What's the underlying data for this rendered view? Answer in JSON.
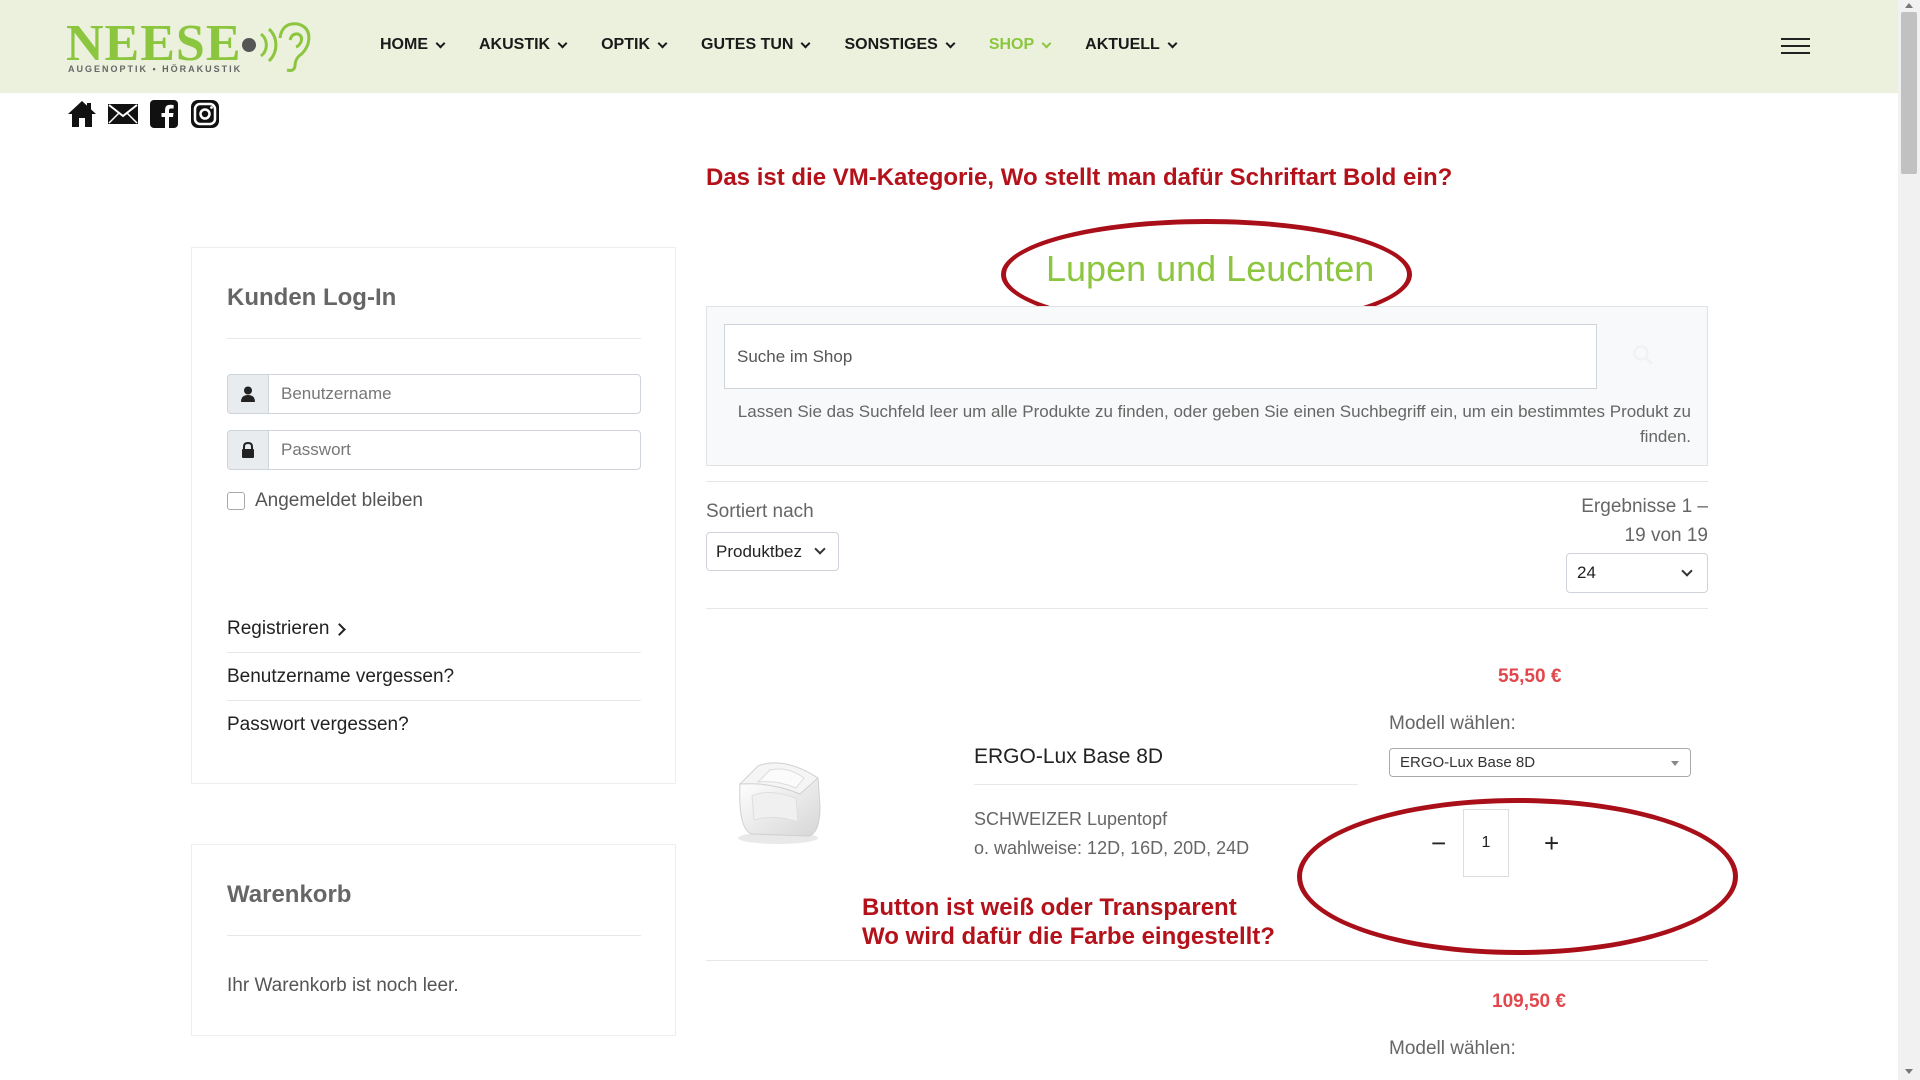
{
  "brand": {
    "name": "NEESE",
    "tagline": "AUGENOPTIK • HÖRAKUSTIK",
    "color": "#8cc63e"
  },
  "nav": {
    "items": [
      {
        "label": "HOME"
      },
      {
        "label": "AKUSTIK"
      },
      {
        "label": "OPTIK"
      },
      {
        "label": "GUTES TUN"
      },
      {
        "label": "SONSTIGES"
      },
      {
        "label": "SHOP"
      },
      {
        "label": "AKTUELL"
      }
    ],
    "active": "SHOP"
  },
  "socials": [
    "home-icon",
    "mail-icon",
    "facebook-icon",
    "instagram-icon"
  ],
  "annotations": {
    "top": "Das ist die VM-Kategorie, Wo stellt man dafür Schriftart Bold ein?",
    "bottom_line1": "Button ist weiß oder Transparent",
    "bottom_line2": "Wo wird dafür die Farbe eingestellt?",
    "color": "#b4121b"
  },
  "login": {
    "title": "Kunden Log-In",
    "username_placeholder": "Benutzername",
    "password_placeholder": "Passwort",
    "remember": "Angemeldet bleiben",
    "register": "Registrieren",
    "forgot_username": "Benutzername vergessen?",
    "forgot_password": "Passwort vergessen?"
  },
  "cart": {
    "title": "Warenkorb",
    "empty": "Ihr Warenkorb ist noch leer."
  },
  "category": {
    "title": "Lupen und Leuchten"
  },
  "search": {
    "placeholder": "Suche im Shop",
    "hint": "Lassen Sie das Suchfeld leer um alle Produkte zu finden, oder geben Sie einen Suchbegriff ein, um ein bestimmtes Produkt zu finden."
  },
  "sorting": {
    "label": "Sortiert nach",
    "value": "Produktbez",
    "results_line1": "Ergebnisse 1 –",
    "results_line2": "19 von 19",
    "per_page": "24"
  },
  "products": [
    {
      "price": "55,50 €",
      "modell_label": "Modell wählen:",
      "modell_value": "ERGO-Lux Base 8D",
      "name": "ERGO-Lux Base 8D",
      "desc_line1": "SCHWEIZER Lupentopf",
      "desc_line2": "o. wahlweise: 12D, 16D, 20D, 24D",
      "quantity": "1",
      "minus": "−",
      "plus": "+"
    },
    {
      "price": "109,50 €",
      "modell_label": "Modell wählen:"
    }
  ]
}
